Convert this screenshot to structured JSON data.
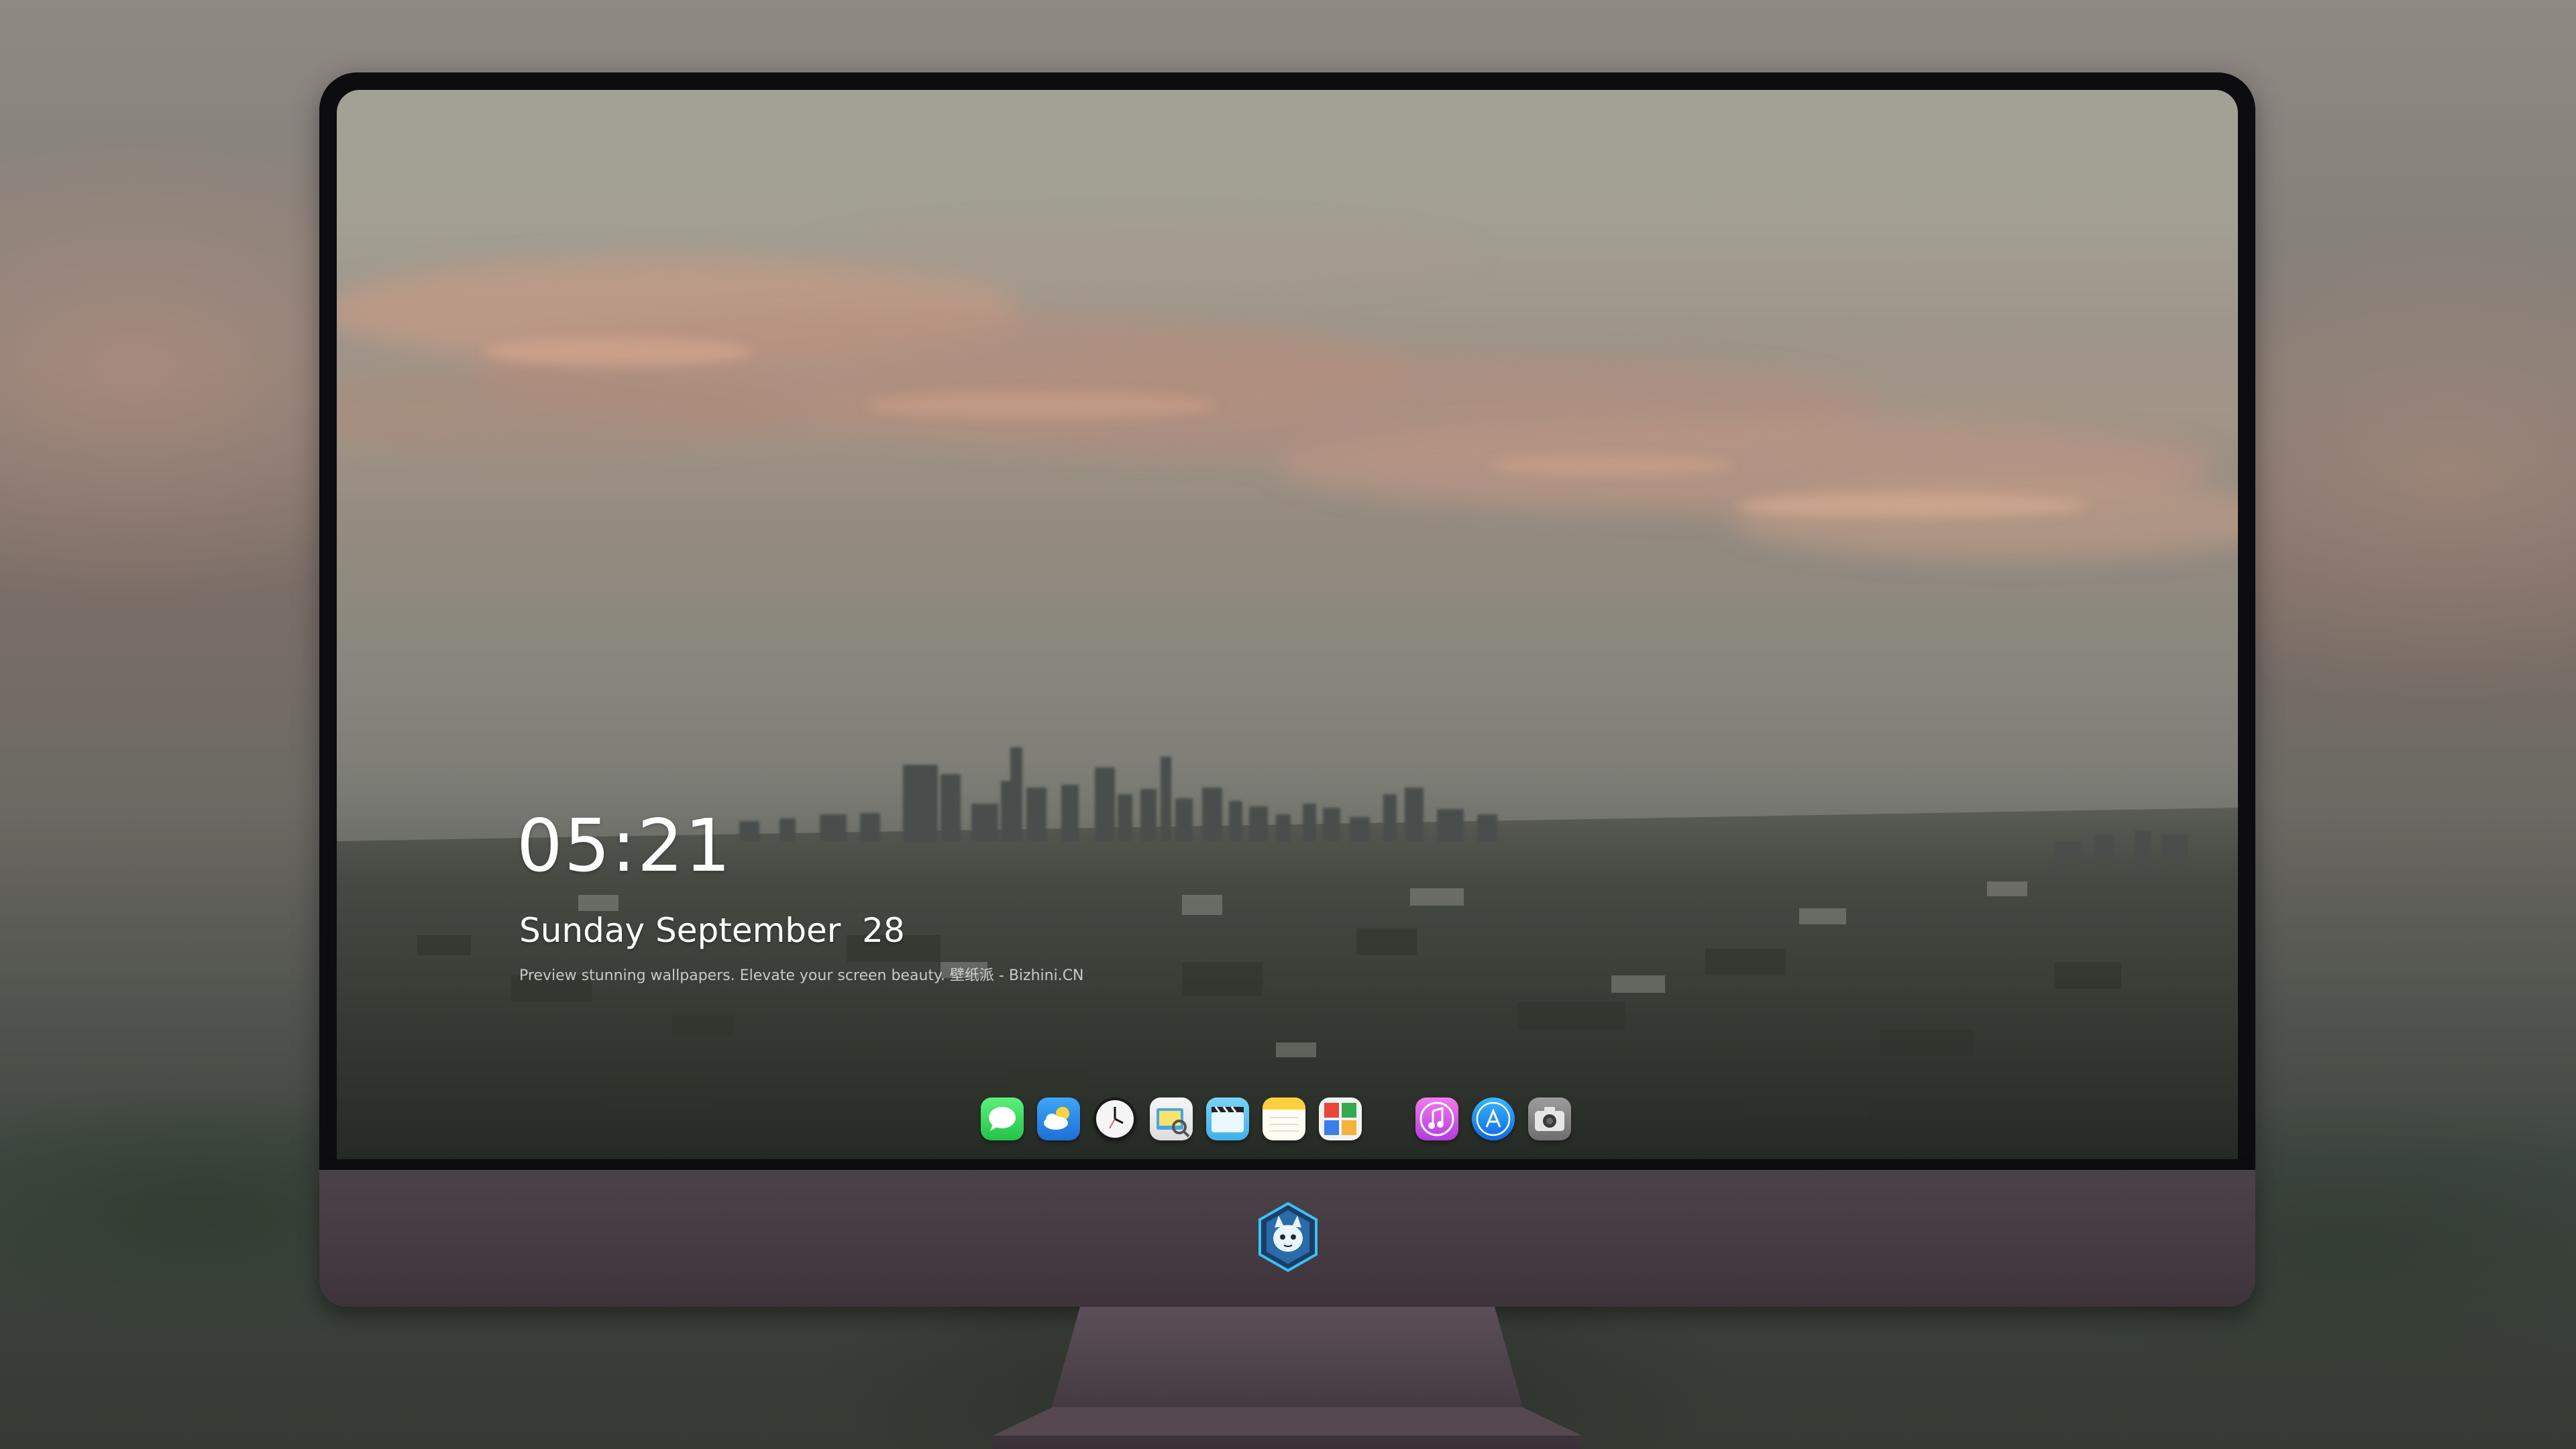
{
  "lockscreen": {
    "time": "05:21",
    "date": "Sunday September  28",
    "caption": "Preview stunning wallpapers. Elevate your screen beauty. 壁纸派 - Bizhini.CN"
  },
  "dock": {
    "apps": [
      {
        "name": "messages-icon",
        "color": "#2fd158"
      },
      {
        "name": "weather-icon",
        "color": "#2f8de6"
      },
      {
        "name": "clock-icon",
        "color": "#f2f2f2"
      },
      {
        "name": "preview-icon",
        "color": "#f2f2f2"
      },
      {
        "name": "clips-icon",
        "color": "#5fc6f0"
      },
      {
        "name": "notes-icon",
        "color": "#ffd54a"
      },
      {
        "name": "photo-booth-icon",
        "color": "#f0f0f0"
      },
      {
        "name": "music-icon",
        "color": "#d94be3"
      },
      {
        "name": "app-store-icon",
        "color": "#1c8ef5"
      },
      {
        "name": "camera-icon",
        "color": "#8a8a8a"
      }
    ]
  },
  "colors": {
    "bezel": "#0d0d0f",
    "chin": "#453a42",
    "text": "#ffffff"
  }
}
